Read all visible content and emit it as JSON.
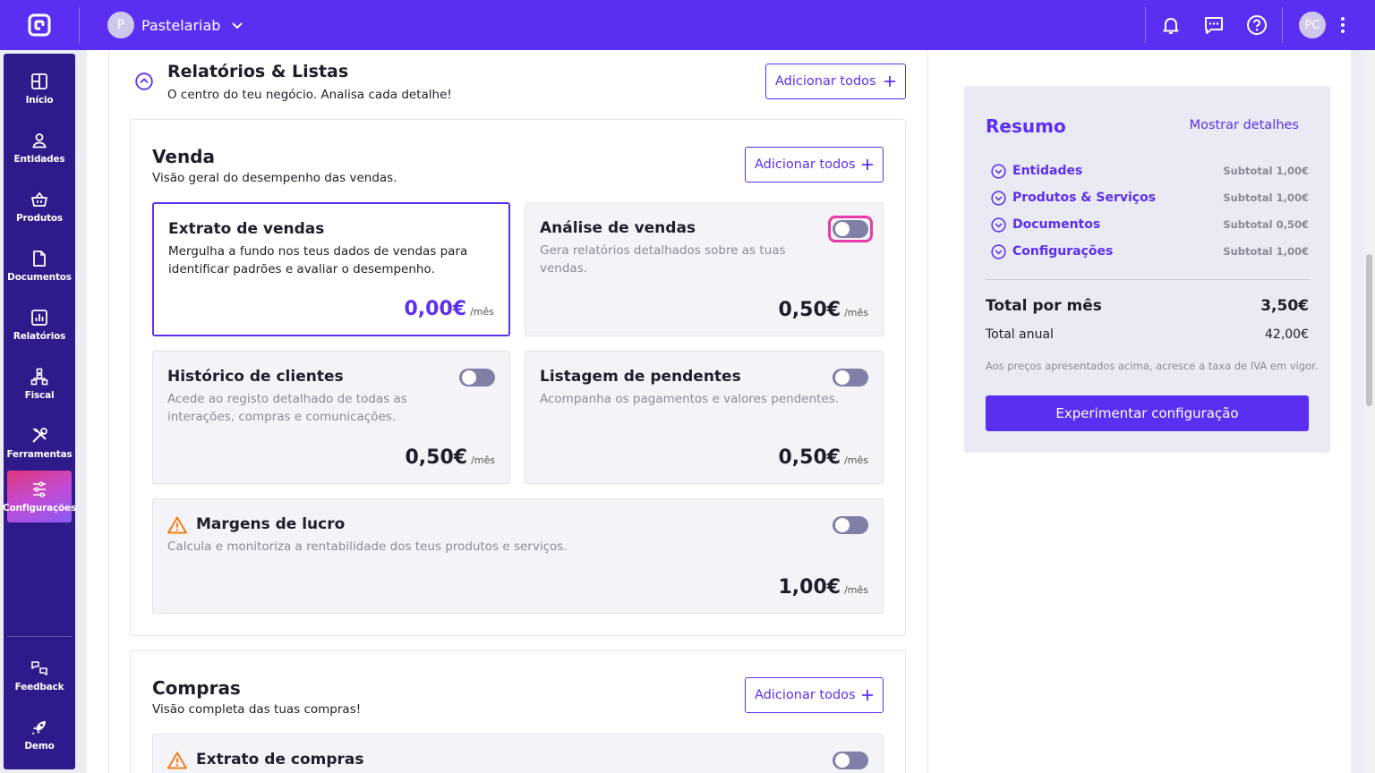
{
  "app": {
    "company_initial": "P",
    "company_name": "Pastelariab",
    "user_initials": "PC"
  },
  "sidebar": {
    "items": [
      {
        "label": "Início",
        "icon": "home-icon"
      },
      {
        "label": "Entidades",
        "icon": "user-icon"
      },
      {
        "label": "Produtos",
        "icon": "basket-icon"
      },
      {
        "label": "Documentos",
        "icon": "document-icon"
      },
      {
        "label": "Relatórios",
        "icon": "chart-icon"
      },
      {
        "label": "Fiscal",
        "icon": "hierarchy-icon"
      },
      {
        "label": "Ferramentas",
        "icon": "tools-icon"
      },
      {
        "label": "Configurações",
        "icon": "sliders-icon",
        "active": true
      }
    ],
    "bottom_items": [
      {
        "label": "Feedback",
        "icon": "feedback-icon"
      },
      {
        "label": "Demo",
        "icon": "rocket-icon"
      }
    ]
  },
  "reports": {
    "title": "Relatórios & Listas",
    "subtitle": "O centro do teu negócio. Analisa cada detalhe!",
    "add_all": "Adicionar todos"
  },
  "venda": {
    "title": "Venda",
    "subtitle": "Visão geral do desempenho das vendas.",
    "add_all": "Adicionar todos",
    "cards": [
      {
        "title": "Extrato de vendas",
        "desc": "Mergulha a fundo nos teus dados de vendas para identificar padrões e avaliar o desempenho.",
        "price": "0,00€",
        "per": "/mês",
        "included": true
      },
      {
        "title": "Análise de vendas",
        "desc": "Gera relatórios detalhados sobre as tuas vendas.",
        "price": "0,50€",
        "per": "/mês",
        "enabled": false
      },
      {
        "title": "Histórico de clientes",
        "desc": "Acede ao registo detalhado de todas as interações, compras e comunicações.",
        "price": "0,50€",
        "per": "/mês",
        "enabled": false
      },
      {
        "title": "Listagem de pendentes",
        "desc": "Acompanha os pagamentos e valores pendentes.",
        "price": "0,50€",
        "per": "/mês",
        "enabled": false
      },
      {
        "title": "Margens de lucro",
        "desc": "Calcula e monitoriza a rentabilidade dos teus produtos e serviços.",
        "price": "1,00€",
        "per": "/mês",
        "enabled": false,
        "warning": true
      }
    ]
  },
  "compras": {
    "title": "Compras",
    "subtitle": "Visão completa das tuas compras!",
    "add_all": "Adicionar todos",
    "cards": [
      {
        "title": "Extrato de compras",
        "enabled": false,
        "warning": true
      }
    ]
  },
  "summary": {
    "title": "Resumo",
    "details_link": "Mostrar detalhes",
    "rows": [
      {
        "label": "Entidades",
        "subtotal": "Subtotal 1,00€"
      },
      {
        "label": "Produtos & Serviços",
        "subtotal": "Subtotal 1,00€"
      },
      {
        "label": "Documentos",
        "subtotal": "Subtotal 0,50€"
      },
      {
        "label": "Configurações",
        "subtotal": "Subtotal 1,00€"
      }
    ],
    "total_month_label": "Total por mês",
    "total_month_value": "3,50€",
    "total_year_label": "Total anual",
    "total_year_value": "42,00€",
    "note": "Aos preços apresentados acima, acresce a taxa de IVA em vigor.",
    "cta": "Experimentar configuração"
  },
  "colors": {
    "brand": "#5b2ff1",
    "sidebar": "#2f1a8c",
    "focus": "#e83aa8",
    "warning": "#f07d1a"
  }
}
